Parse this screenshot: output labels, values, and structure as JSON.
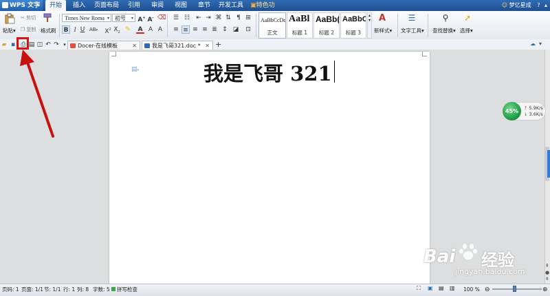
{
  "menubar": {
    "app_title": "WPS 文字",
    "tabs": [
      "开始",
      "插入",
      "页面布局",
      "引用",
      "审阅",
      "视图",
      "章节",
      "开发工具",
      "特色功能"
    ],
    "right_label": "梦亿星成"
  },
  "ribbon": {
    "paste": "粘贴",
    "cut": "剪切",
    "copy": "复制",
    "format_painter": "格式刷",
    "font_name": "Times New Roma",
    "font_size": "初号",
    "styles": [
      {
        "preview": "AaBbCcDd",
        "name": "正文"
      },
      {
        "preview": "AaBl",
        "name": "标题 1"
      },
      {
        "preview": "AaBb(",
        "name": "标题 2"
      },
      {
        "preview": "AaBbC",
        "name": "标题 3"
      }
    ],
    "new_style": "新样式",
    "text_tools": "文字工具",
    "find_replace": "查找替换",
    "select": "选择"
  },
  "tabs": {
    "docer": "Docer-在线模板",
    "document": "我是飞哥321.doc *",
    "new_tab": "+"
  },
  "document": {
    "text": "我是飞哥 321"
  },
  "speed_widget": {
    "percent": "45%",
    "up": "5.9K/s",
    "down": "3.6K/s"
  },
  "statusbar": {
    "page_num": "页码: 1",
    "pages": "页面: 1/1",
    "section": "节: 1/1",
    "row": "行: 1",
    "col": "列: 8",
    "word_count": "字数: 5",
    "spell_check": "拼写检查",
    "zoom": "100 %"
  },
  "watermark": {
    "brand": "Bai",
    "brand_cn": "经验",
    "url": "jingyan.baidu.com"
  },
  "colors": {
    "menubar": "#1f4f8f",
    "annotation": "#d11111",
    "speed_green": "#1f9a44"
  }
}
